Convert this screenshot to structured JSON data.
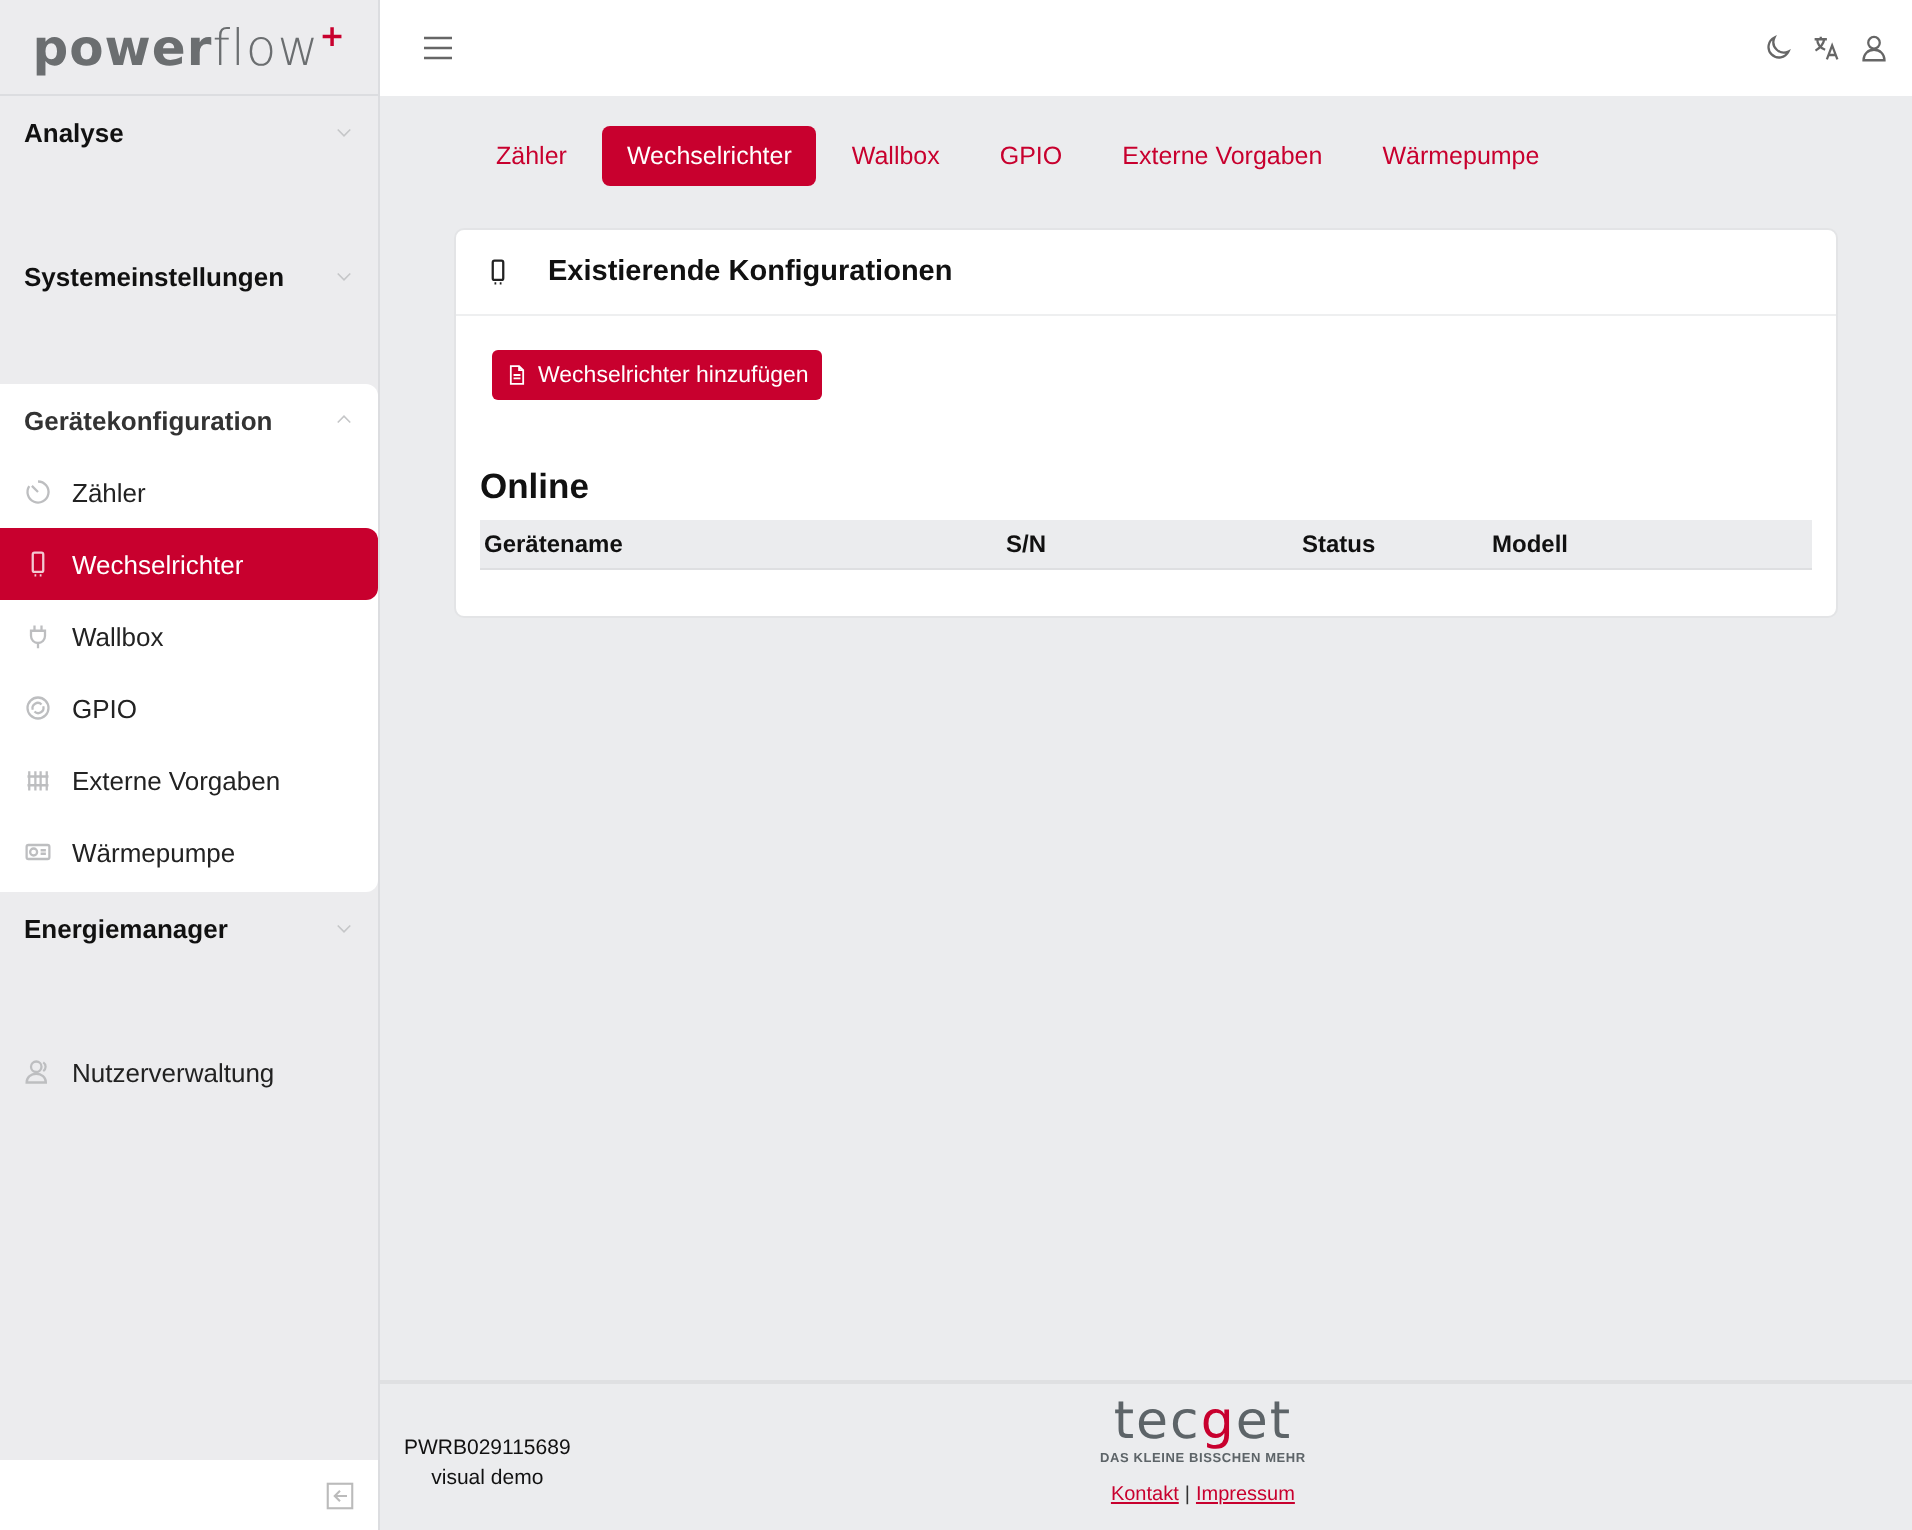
{
  "logo": "**power**flow$^{+}$",
  "sidebar": {
    "items": [
      {
        "kind": "group",
        "label": "Analyse",
        "expanded": false
      },
      {
        "kind": "group",
        "label": "Systemeinstellungen",
        "expanded": false
      },
      {
        "kind": "group",
        "label": "Gerätekonfiguration",
        "expanded": true,
        "children": [
          {
            "label": "Zähler",
            "selected": false
          },
          {
            "label": "Wechselrichter",
            "selected": true
          },
          {
            "label": "Wallbox",
            "selected": false
          },
          {
            "label": "GPIO",
            "selected": false
          },
          {
            "label": "Externe Vorgaben",
            "selected": false
          },
          {
            "label": "Wärmepumpe",
            "selected": false
          }
        ]
      },
      {
        "kind": "group",
        "label": "Energiemanager",
        "expanded": false
      },
      {
        "kind": "link",
        "label": "Nutzerverwaltung"
      }
    ]
  },
  "tabs": [
    {
      "label": "Zähler",
      "selected": false
    },
    {
      "label": "Wechselrichter",
      "selected": true
    },
    {
      "label": "Wallbox",
      "selected": false
    },
    {
      "label": "GPIO",
      "selected": false
    },
    {
      "label": "Externe Vorgaben",
      "selected": false
    },
    {
      "label": "Wärmepumpe",
      "selected": false
    }
  ],
  "card": {
    "title": "Existierende Konfigurationen",
    "add_button": "Wechselrichter hinzufügen",
    "section": "Online",
    "table": {
      "columns": [
        "Gerätename",
        "S/N",
        "Status",
        "Modell"
      ]
    }
  },
  "footer": {
    "serial": "PWRB029115689",
    "mode": "visual demo",
    "brand": [
      {
        "text": "tec",
        "accent": false
      },
      {
        "text": "g",
        "accent": true
      },
      {
        "text": "et",
        "accent": false
      }
    ],
    "tagline": "DAS KLEINE BISSCHEN MEHR",
    "links": [
      {
        "kind": "link",
        "text": "Kontakt"
      },
      {
        "kind": "sep",
        "text": "|"
      },
      {
        "kind": "link",
        "text": "Impressum"
      }
    ]
  }
}
